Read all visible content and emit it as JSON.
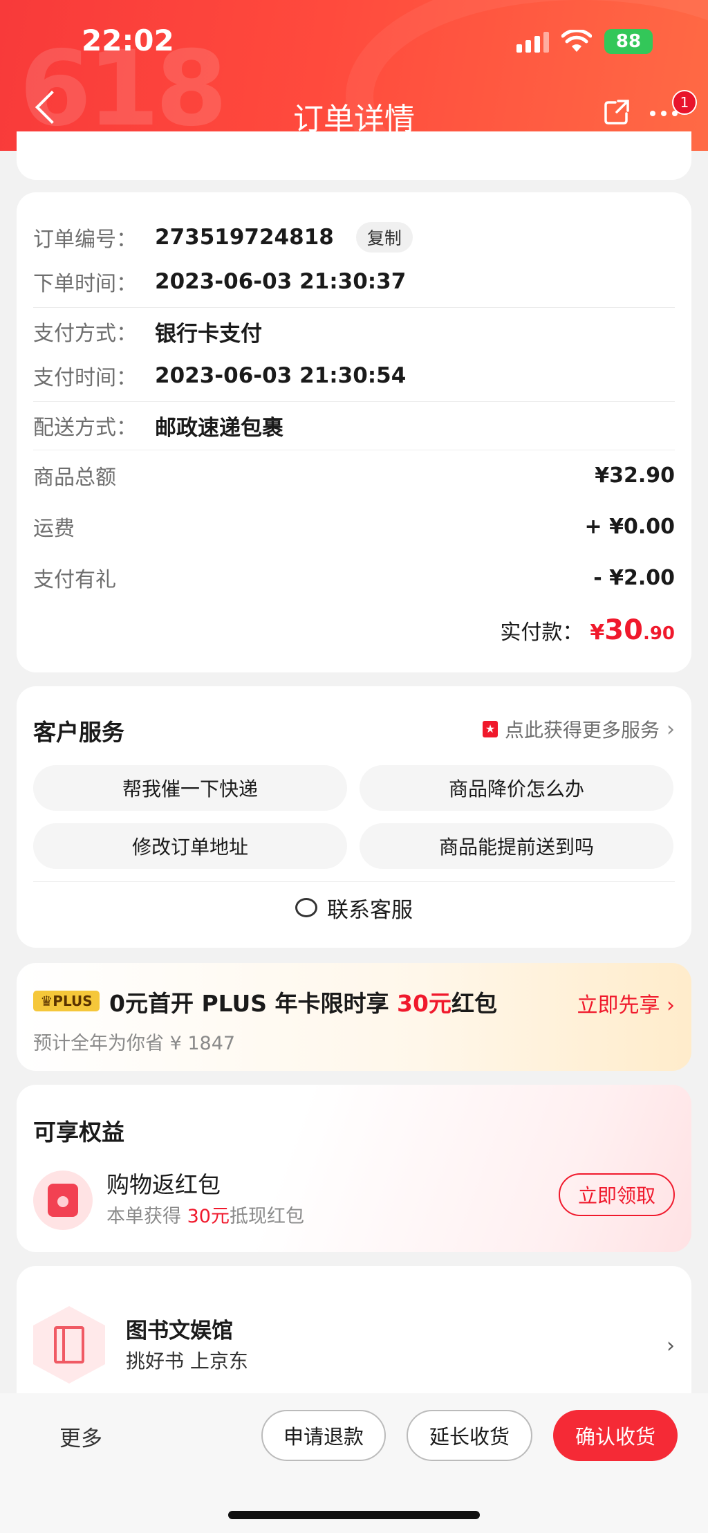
{
  "status_bar": {
    "time": "22:02",
    "battery": "88"
  },
  "header": {
    "title": "订单详情",
    "watermark": "618",
    "notification_count": "1",
    "colors": {
      "header_start": "#f83a3a",
      "header_end": "#ff6a45"
    }
  },
  "order": {
    "rows": [
      {
        "label": "订单编号：",
        "value": "273519724818"
      },
      {
        "label": "下单时间：",
        "value": "2023-06-03 21:30:37"
      },
      {
        "label": "支付方式：",
        "value": "银行卡支付"
      },
      {
        "label": "支付时间：",
        "value": "2023-06-03 21:30:54"
      },
      {
        "label": "配送方式：",
        "value": "邮政速递包裹"
      }
    ],
    "copy_label": "复制",
    "amounts": [
      {
        "label": "商品总额",
        "value": "¥32.90"
      },
      {
        "label": "运费",
        "value": "+ ¥0.00"
      },
      {
        "label": "支付有礼",
        "value": "- ¥2.00"
      }
    ],
    "paid": {
      "label": "实付款：",
      "currency": "¥",
      "integer": "30",
      "decimal": ".90"
    }
  },
  "service": {
    "title": "客户服务",
    "more": "点此获得更多服务",
    "buttons": [
      "帮我催一下快递",
      "商品降价怎么办",
      "修改订单地址",
      "商品能提前送到吗"
    ],
    "contact": "联系客服"
  },
  "plus": {
    "tag": "PLUS",
    "title_prefix": "0元首开 PLUS 年卡限时享 ",
    "title_highlight": "30元",
    "title_suffix": "红包",
    "subtitle": "预计全年为你省 ¥ 1847",
    "cta": "立即先享 ›"
  },
  "benefits": {
    "title": "可享权益",
    "name": "购物返红包",
    "desc_prefix": "本单获得 ",
    "desc_highlight": "30元",
    "desc_suffix": "抵现红包",
    "button": "立即领取"
  },
  "store": {
    "name": "图书文娱馆",
    "subtitle": "挑好书 上京东",
    "chevron": "›"
  },
  "bottom_bar": {
    "more": "更多",
    "refund": "申请退款",
    "extend": "延长收货",
    "confirm": "确认收货"
  }
}
